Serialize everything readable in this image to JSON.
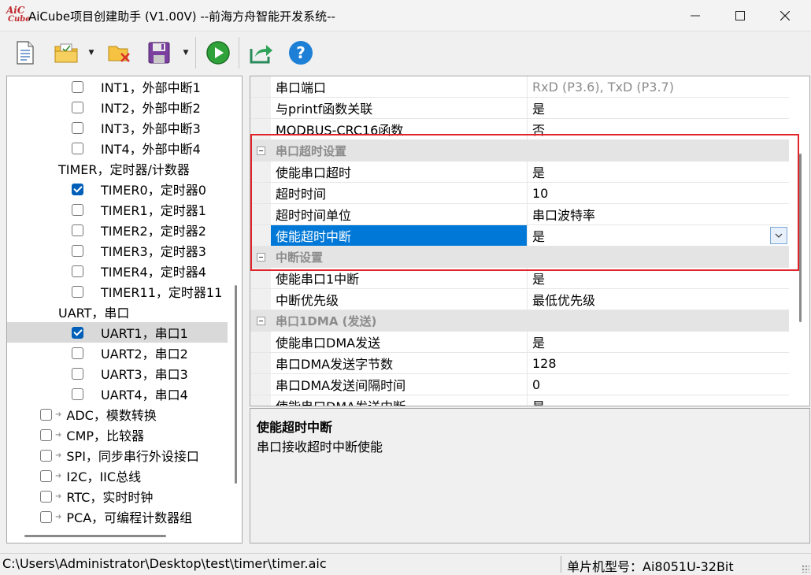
{
  "window": {
    "title": "AiCube项目创建助手 (V1.00V) --前海方舟智能开发系统--",
    "logo_line1": "AiC",
    "logo_line2": "Cube",
    "controls": {
      "minimize_icon": "minimize-icon",
      "maximize_icon": "maximize-icon",
      "close_icon": "close-icon"
    }
  },
  "toolbar": {
    "buttons": [
      {
        "name": "new-project-button",
        "icon": "new-document-icon"
      },
      {
        "name": "open-project-button",
        "icon": "open-folder-icon"
      },
      {
        "name": "close-project-button",
        "icon": "folder-close-icon"
      },
      {
        "name": "save-project-button",
        "icon": "save-icon"
      },
      {
        "name": "run-button",
        "icon": "play-icon"
      },
      {
        "name": "export-button",
        "icon": "export-icon"
      },
      {
        "name": "help-button",
        "icon": "help-icon"
      }
    ]
  },
  "tree": {
    "items": [
      {
        "label": "INT1，外部中断1",
        "checked": false
      },
      {
        "label": "INT2，外部中断2",
        "checked": false
      },
      {
        "label": "INT3，外部中断3",
        "checked": false
      },
      {
        "label": "INT4，外部中断4",
        "checked": false
      },
      {
        "label": "TIMER，定时器/计数器"
      },
      {
        "label": "TIMER0，定时器0",
        "checked": true
      },
      {
        "label": "TIMER1，定时器1",
        "checked": false
      },
      {
        "label": "TIMER2，定时器2",
        "checked": false
      },
      {
        "label": "TIMER3，定时器3",
        "checked": false
      },
      {
        "label": "TIMER4，定时器4",
        "checked": false
      },
      {
        "label": "TIMER11，定时器11",
        "checked": false
      },
      {
        "label": "UART，串口"
      },
      {
        "label": "UART1，串口1",
        "checked": true,
        "selected": true
      },
      {
        "label": "UART2，串口2",
        "checked": false
      },
      {
        "label": "UART3，串口3",
        "checked": false
      },
      {
        "label": "UART4，串口4",
        "checked": false
      },
      {
        "label": "ADC，模数转换",
        "checked": false
      },
      {
        "label": "CMP，比较器",
        "checked": false
      },
      {
        "label": "SPI，同步串行外设接口",
        "checked": false
      },
      {
        "label": "I2C，IIC总线",
        "checked": false
      },
      {
        "label": "RTC，实时时钟",
        "checked": false
      },
      {
        "label": "PCA，可编程计数器组",
        "checked": false
      }
    ]
  },
  "properties": {
    "rows": [
      {
        "type": "prop",
        "name": "串口端口",
        "value": "RxD (P3.6), TxD (P3.7)",
        "readonly": true
      },
      {
        "type": "prop",
        "name": "与printf函数关联",
        "value": "是"
      },
      {
        "type": "prop",
        "name": "MODBUS-CRC16函数",
        "value": "否"
      },
      {
        "type": "category",
        "name": "串口超时设置"
      },
      {
        "type": "prop",
        "name": "使能串口超时",
        "value": "是"
      },
      {
        "type": "prop",
        "name": "超时时间",
        "value": "10"
      },
      {
        "type": "prop",
        "name": "超时时间单位",
        "value": "串口波特率"
      },
      {
        "type": "prop",
        "name": "使能超时中断",
        "value": "是",
        "selected": true
      },
      {
        "type": "category",
        "name": "中断设置"
      },
      {
        "type": "prop",
        "name": "使能串口1中断",
        "value": "是"
      },
      {
        "type": "prop",
        "name": "中断优先级",
        "value": "最低优先级"
      },
      {
        "type": "category",
        "name": "串口1DMA (发送)"
      },
      {
        "type": "prop",
        "name": "使能串口DMA发送",
        "value": "是"
      },
      {
        "type": "prop",
        "name": "串口DMA发送字节数",
        "value": "128"
      },
      {
        "type": "prop",
        "name": "串口DMA发送间隔时间",
        "value": "0"
      },
      {
        "type": "prop",
        "name": "使能串口DMA发送中断",
        "value": "是"
      }
    ]
  },
  "description": {
    "title": "使能超时中断",
    "text": "串口接收超时中断使能"
  },
  "status": {
    "path": "C:\\Users\\Administrator\\Desktop\\test\\timer\\timer.aic",
    "chip": "单片机型号：Ai8051U-32Bit"
  },
  "colors": {
    "selection": "#0078d7",
    "highlight_box": "#e0242a",
    "checkbox_checked": "#005fb8"
  }
}
